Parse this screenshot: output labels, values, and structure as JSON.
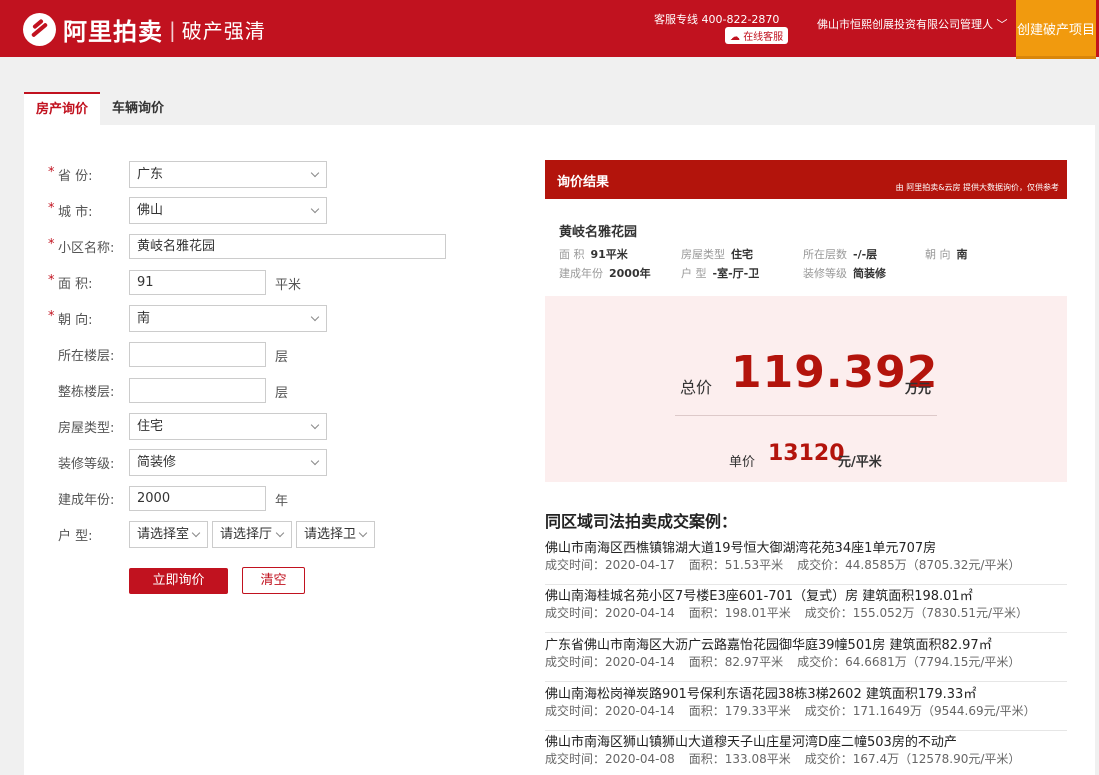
{
  "header": {
    "brand": "阿里拍卖",
    "brand_sub": "破产强清",
    "hotline": "客服专线  400-822-2870",
    "online_service": "在线客服",
    "user": "佛山市恒熙创展投资有限公司管理人",
    "create_project": "创建破产项目"
  },
  "tabs": [
    {
      "label": "房产询价",
      "active": true
    },
    {
      "label": "车辆询价",
      "active": false
    }
  ],
  "form": {
    "province": {
      "label": "省     份:",
      "value": "广东"
    },
    "city": {
      "label": "城     市:",
      "value": "佛山"
    },
    "community": {
      "label": "小区名称:",
      "value": "黄岐名雅花园"
    },
    "area": {
      "label": "面     积:",
      "value": "91",
      "unit": "平米"
    },
    "orientation": {
      "label": "朝     向:",
      "value": "南"
    },
    "floor": {
      "label": "所在楼层:",
      "value": "",
      "unit": "层"
    },
    "total_floors": {
      "label": "整栋楼层:",
      "value": "",
      "unit": "层"
    },
    "house_type": {
      "label": "房屋类型:",
      "value": "住宅"
    },
    "decoration": {
      "label": "装修等级:",
      "value": "简装修"
    },
    "build_year": {
      "label": "建成年份:",
      "value": "2000",
      "unit": "年"
    },
    "layout": {
      "label": "户     型:",
      "room": "请选择室",
      "hall": "请选择厅",
      "bath": "请选择卫"
    },
    "submit_label": "立即询价",
    "clear_label": "清空"
  },
  "result": {
    "title": "询价结果",
    "note": "由 阿里拍卖&云房 提供大数据询价，仅供参考",
    "property_name": "黄岐名雅花园",
    "details": {
      "area_k": "面    积",
      "area_v": "91平米",
      "type_k": "房屋类型",
      "type_v": "住宅",
      "floor_k": "所在层数",
      "floor_v": "-/-层",
      "orient_k": "朝    向",
      "orient_v": "南",
      "year_k": "建成年份",
      "year_v": "2000年",
      "layout_k": "户    型",
      "layout_v": "-室-厅-卫",
      "deco_k": "装修等级",
      "deco_v": "简装修"
    },
    "total_label": "总价",
    "total_value": "119.392",
    "total_unit": "万元",
    "unit_label": "单价",
    "unit_value": "13120",
    "unit_unit": "元/平米"
  },
  "cases": {
    "title": "同区域司法拍卖成交案例：",
    "items": [
      {
        "title": "佛山市南海区西樵镇锦湖大道19号恒大御湖湾花苑34座1单元707房",
        "time": "成交时间：2020-04-17",
        "area": "面积：51.53平米",
        "price": "成交价：44.8585万（8705.32元/平米）"
      },
      {
        "title": "佛山南海桂城名苑小区7号楼E3座601-701（复式）房 建筑面积198.01㎡",
        "time": "成交时间：2020-04-14",
        "area": "面积：198.01平米",
        "price": "成交价：155.052万（7830.51元/平米）"
      },
      {
        "title": "广东省佛山市南海区大沥广云路嘉怡花园御华庭39幢501房 建筑面积82.97㎡",
        "time": "成交时间：2020-04-14",
        "area": "面积：82.97平米",
        "price": "成交价：64.6681万（7794.15元/平米）"
      },
      {
        "title": "佛山南海松岗禅炭路901号保利东语花园38栋3梯2602 建筑面积179.33㎡",
        "time": "成交时间：2020-04-14",
        "area": "面积：179.33平米",
        "price": "成交价：171.1649万（9544.69元/平米）"
      },
      {
        "title": "佛山市南海区狮山镇狮山大道穆天子山庄星河湾D座二幢503房的不动产",
        "time": "成交时间：2020-04-08",
        "area": "面积：133.08平米",
        "price": "成交价：167.4万（12578.90元/平米）"
      }
    ]
  }
}
